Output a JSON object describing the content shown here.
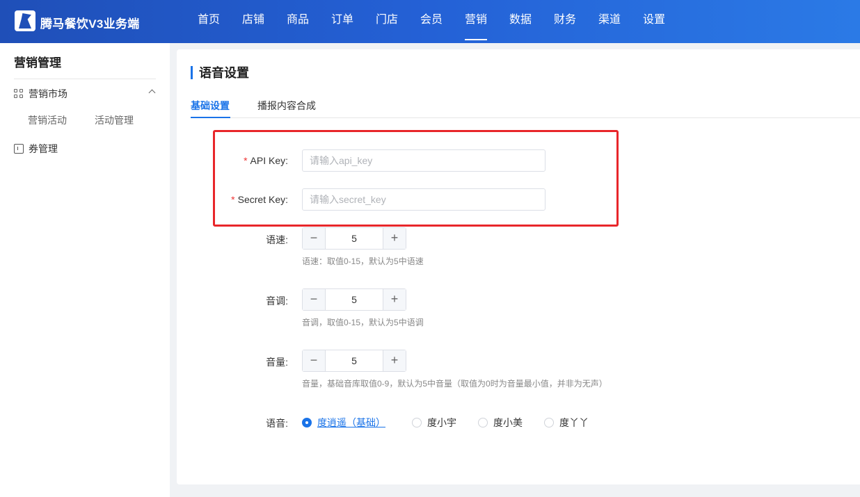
{
  "header": {
    "brand": "腾马餐饮V3业务端",
    "nav": [
      "首页",
      "店铺",
      "商品",
      "订单",
      "门店",
      "会员",
      "营销",
      "数据",
      "财务",
      "渠道",
      "设置"
    ],
    "active_nav": "营销"
  },
  "sidebar": {
    "title": "营销管理",
    "groups": [
      {
        "label": "营销市场",
        "icon": "grid-icon",
        "children": [
          "营销活动",
          "活动管理"
        ]
      },
      {
        "label": "券管理",
        "icon": "ticket-icon"
      }
    ]
  },
  "main": {
    "title": "语音设置",
    "tabs": [
      "基础设置",
      "播报内容合成"
    ],
    "active_tab": "基础设置",
    "form": {
      "api_key": {
        "label": "API Key:",
        "placeholder": "请输入api_key",
        "required": true
      },
      "secret_key": {
        "label": "Secret Key:",
        "placeholder": "请输入secret_key",
        "required": true
      },
      "speed": {
        "label": "语速:",
        "value": "5",
        "hint": "语速：取值0-15，默认为5中语速"
      },
      "pitch": {
        "label": "音调:",
        "value": "5",
        "hint": "音调，取值0-15，默认为5中语调"
      },
      "volume": {
        "label": "音量:",
        "value": "5",
        "hint": "音量，基础音库取值0-9，默认为5中音量（取值为0时为音量最小值，并非为无声）"
      },
      "voice": {
        "label": "语音:",
        "options": [
          "度逍遥（基础）",
          "度小宇",
          "度小美",
          "度丫丫"
        ],
        "selected": "度逍遥（基础）"
      }
    }
  },
  "colors": {
    "primary": "#1a73e8",
    "header_start": "#1f4fb8",
    "header_end": "#2b7ae6",
    "highlight_box": "#e8262a"
  }
}
